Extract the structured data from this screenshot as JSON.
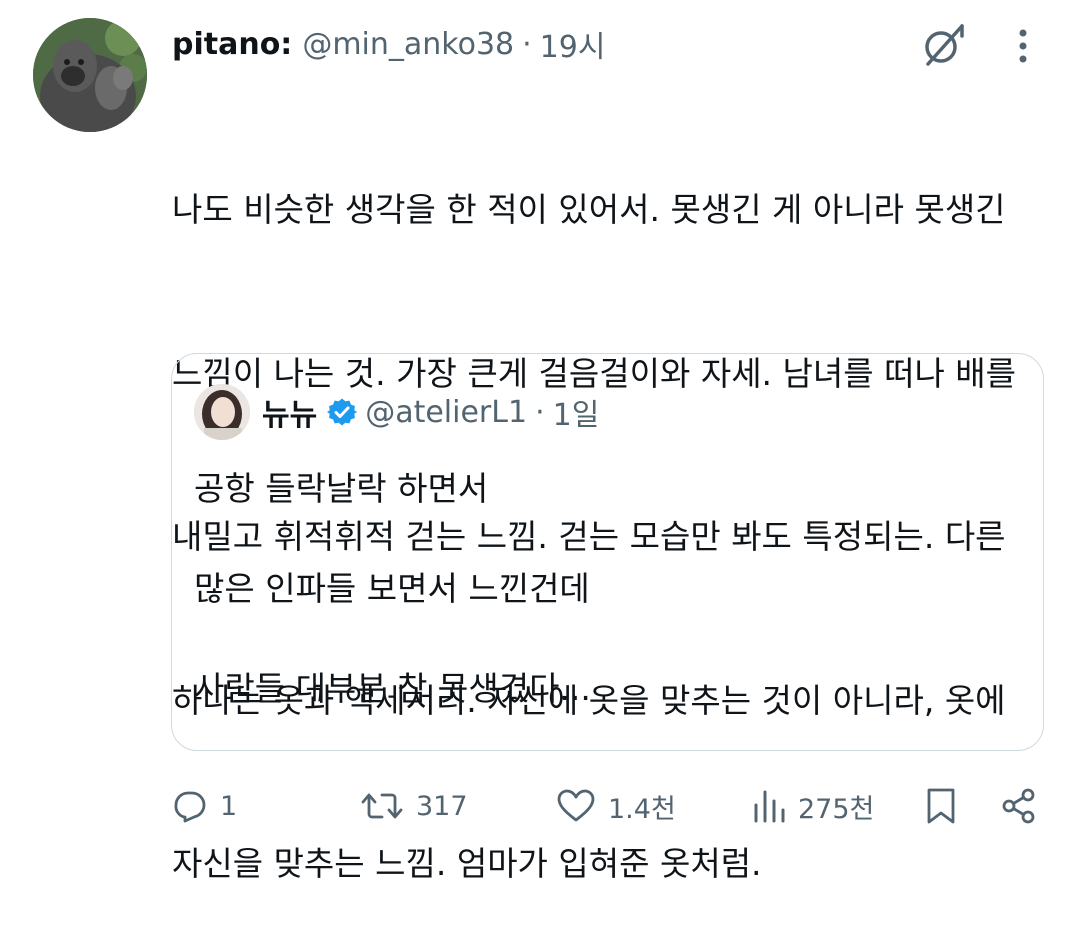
{
  "tweet": {
    "display_name": "pitano:",
    "handle": "@min_anko38",
    "separator": "·",
    "time": "19시",
    "lines": [
      "나도 비슷한 생각을 한 적이 있어서. 못생긴 게 아니라 못생긴",
      "느낌이 나는 것. 가장 큰게 걸음걸이와 자세. 남녀를 떠나 배를",
      "내밀고 휘적휘적 걷는 느낌. 걷는 모습만 봐도 특정되는. 다른",
      "하나는 옷과 액세서리. 자신에 옷을 맞추는 것이 아니라, 옷에",
      "자신을 맞추는 느낌. 엄마가 입혀준 옷처럼."
    ],
    "avatar_icon": "gorilla-avatar",
    "grok_icon": "grok-icon",
    "more_icon": "more-dots-icon"
  },
  "quote": {
    "display_name": "뉴뉴",
    "verified_icon": "verified-badge-icon",
    "verified_color": "#1d9bf0",
    "handle": "@atelierL1",
    "separator": "·",
    "time": "1일",
    "lines": [
      "공항 들락날락 하면서",
      "",
      "많은 인파들 보면서 느낀건데",
      "",
      "사람들 대부분 참 못생겼다..."
    ]
  },
  "actions": {
    "reply": {
      "icon": "reply-icon",
      "count": "1"
    },
    "repost": {
      "icon": "repost-icon",
      "count": "317"
    },
    "like": {
      "icon": "heart-icon",
      "count": "1.4천"
    },
    "views": {
      "icon": "views-chart-icon",
      "count": "275천"
    },
    "bookmark": {
      "icon": "bookmark-icon"
    },
    "share": {
      "icon": "share-icon"
    }
  },
  "colors": {
    "text": "#0f1419",
    "secondary": "#536471",
    "border": "#cfd9de",
    "verified": "#1d9bf0"
  }
}
